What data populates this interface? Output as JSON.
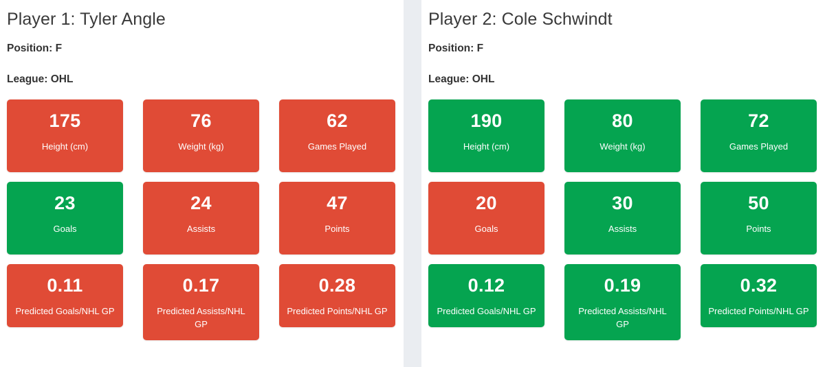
{
  "colors": {
    "red": "#e04b36",
    "green": "#05a450",
    "divider": "#eaedf1",
    "background": "#ffffff",
    "heading_text": "#3a3a3a",
    "meta_text": "#333333",
    "card_text": "#ffffff"
  },
  "players": [
    {
      "title": "Player 1: Tyler Angle",
      "position_line": "Position: F",
      "league_line": "League: OHL",
      "position_value": "F",
      "league_value": "OHL",
      "cards": [
        [
          {
            "value": "175",
            "label": "Height (cm)",
            "color": "red"
          },
          {
            "value": "76",
            "label": "Weight (kg)",
            "color": "red"
          },
          {
            "value": "62",
            "label": "Games Played",
            "color": "red"
          }
        ],
        [
          {
            "value": "23",
            "label": "Goals",
            "color": "green"
          },
          {
            "value": "24",
            "label": "Assists",
            "color": "red"
          },
          {
            "value": "47",
            "label": "Points",
            "color": "red"
          }
        ],
        [
          {
            "value": "0.11",
            "label": "Predicted Goals/NHL GP",
            "color": "red"
          },
          {
            "value": "0.17",
            "label": "Predicted Assists/NHL GP",
            "color": "red"
          },
          {
            "value": "0.28",
            "label": "Predicted Points/NHL GP",
            "color": "red"
          }
        ]
      ]
    },
    {
      "title": "Player 2: Cole Schwindt",
      "position_line": "Position: F",
      "league_line": "League: OHL",
      "position_value": "F",
      "league_value": "OHL",
      "cards": [
        [
          {
            "value": "190",
            "label": "Height (cm)",
            "color": "green"
          },
          {
            "value": "80",
            "label": "Weight (kg)",
            "color": "green"
          },
          {
            "value": "72",
            "label": "Games Played",
            "color": "green"
          }
        ],
        [
          {
            "value": "20",
            "label": "Goals",
            "color": "red"
          },
          {
            "value": "30",
            "label": "Assists",
            "color": "green"
          },
          {
            "value": "50",
            "label": "Points",
            "color": "green"
          }
        ],
        [
          {
            "value": "0.12",
            "label": "Predicted Goals/NHL GP",
            "color": "green"
          },
          {
            "value": "0.19",
            "label": "Predicted Assists/NHL GP",
            "color": "green"
          },
          {
            "value": "0.32",
            "label": "Predicted Points/NHL GP",
            "color": "green"
          }
        ]
      ]
    }
  ]
}
